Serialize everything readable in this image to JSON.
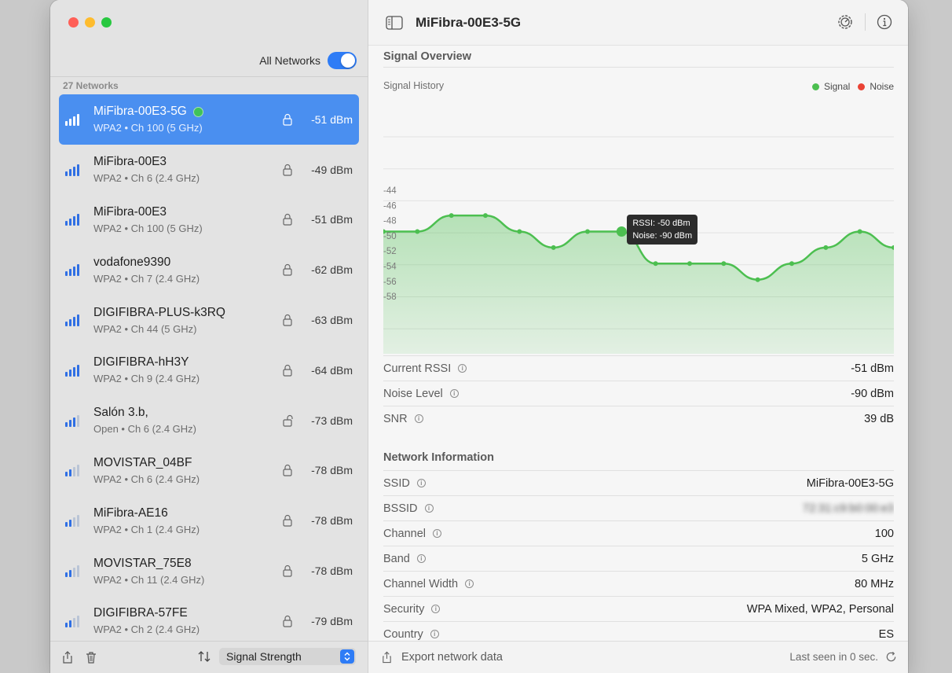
{
  "window": {
    "title": "MiFibra-00E3-5G"
  },
  "sidebar": {
    "filter_label": "All Networks",
    "filter_on": true,
    "count_label": "27 Networks",
    "sort_label": "Signal Strength",
    "networks": [
      {
        "name": "MiFibra-00E3-5G",
        "sub": "WPA2 • Ch 100 (5 GHz)",
        "rssi": "-51 dBm",
        "bars": 4,
        "locked": true,
        "selected": true,
        "connected": true
      },
      {
        "name": "MiFibra-00E3",
        "sub": "WPA2 • Ch 6 (2.4 GHz)",
        "rssi": "-49 dBm",
        "bars": 4,
        "locked": true,
        "selected": false,
        "connected": false
      },
      {
        "name": "MiFibra-00E3",
        "sub": "WPA2 • Ch 100 (5 GHz)",
        "rssi": "-51 dBm",
        "bars": 4,
        "locked": true,
        "selected": false,
        "connected": false
      },
      {
        "name": "vodafone9390",
        "sub": "WPA2 • Ch 7 (2.4 GHz)",
        "rssi": "-62 dBm",
        "bars": 4,
        "locked": true,
        "selected": false,
        "connected": false
      },
      {
        "name": "DIGIFIBRA-PLUS-k3RQ",
        "sub": "WPA2 • Ch 44 (5 GHz)",
        "rssi": "-63 dBm",
        "bars": 4,
        "locked": true,
        "selected": false,
        "connected": false
      },
      {
        "name": "DIGIFIBRA-hH3Y",
        "sub": "WPA2 • Ch 9 (2.4 GHz)",
        "rssi": "-64 dBm",
        "bars": 4,
        "locked": true,
        "selected": false,
        "connected": false
      },
      {
        "name": "Salón 3.b,",
        "sub": "Open • Ch 6 (2.4 GHz)",
        "rssi": "-73 dBm",
        "bars": 3,
        "locked": false,
        "selected": false,
        "connected": false
      },
      {
        "name": "MOVISTAR_04BF",
        "sub": "WPA2 • Ch 6 (2.4 GHz)",
        "rssi": "-78 dBm",
        "bars": 2,
        "locked": true,
        "selected": false,
        "connected": false
      },
      {
        "name": "MiFibra-AE16",
        "sub": "WPA2 • Ch 1 (2.4 GHz)",
        "rssi": "-78 dBm",
        "bars": 2,
        "locked": true,
        "selected": false,
        "connected": false
      },
      {
        "name": "MOVISTAR_75E8",
        "sub": "WPA2 • Ch 11 (2.4 GHz)",
        "rssi": "-78 dBm",
        "bars": 2,
        "locked": true,
        "selected": false,
        "connected": false
      },
      {
        "name": "DIGIFIBRA-57FE",
        "sub": "WPA2 • Ch 2 (2.4 GHz)",
        "rssi": "-79 dBm",
        "bars": 2,
        "locked": true,
        "selected": false,
        "connected": false
      }
    ]
  },
  "main": {
    "signal_overview_title": "Signal Overview",
    "chart_caption": "Signal History",
    "legend_signal": "Signal",
    "legend_noise": "Noise",
    "tooltip_rssi": "RSSI: -50 dBm",
    "tooltip_noise": "Noise: -90 dBm",
    "metrics": [
      {
        "label": "Current RSSI",
        "value": "-51 dBm"
      },
      {
        "label": "Noise Level",
        "value": "-90 dBm"
      },
      {
        "label": "SNR",
        "value": "39 dB"
      }
    ],
    "network_info_title": "Network Information",
    "network_info": [
      {
        "label": "SSID",
        "value": "MiFibra-00E3-5G"
      },
      {
        "label": "BSSID",
        "value": "72:31:c9:b0:00:e3",
        "redacted": true
      },
      {
        "label": "Channel",
        "value": "100"
      },
      {
        "label": "Band",
        "value": "5 GHz"
      },
      {
        "label": "Channel Width",
        "value": "80 MHz"
      },
      {
        "label": "Security",
        "value": "WPA Mixed, WPA2, Personal"
      },
      {
        "label": "Country",
        "value": "ES"
      }
    ],
    "export_label": "Export network data",
    "last_seen": "Last seen in 0 sec."
  },
  "colors": {
    "signal": "#4cbf50",
    "noise": "#ea4335",
    "accent": "#2e7cf6",
    "selection": "#4a8ff0"
  },
  "icons": {
    "sidebar_toggle": "sidebar-icon",
    "settings": "gear-icon",
    "info": "info-icon",
    "share": "share-icon",
    "trash": "trash-icon",
    "sort": "sort-arrows-icon",
    "refresh": "refresh-icon"
  },
  "chart_data": {
    "type": "line",
    "title": "Signal History",
    "series": [
      {
        "name": "Signal",
        "values": [
          -50,
          -50,
          -48,
          -48,
          -50,
          -52,
          -50,
          -50,
          -54,
          -54,
          -54,
          -56,
          -54,
          -52,
          -50,
          -52
        ]
      }
    ],
    "y_ticks": [
      "-44",
      "-46",
      "-48",
      "-50",
      "-52",
      "-54",
      "-56",
      "-58"
    ],
    "ylim": [
      -58,
      -44
    ],
    "highlight_index": 7,
    "grid": true,
    "legend": "top-right"
  }
}
